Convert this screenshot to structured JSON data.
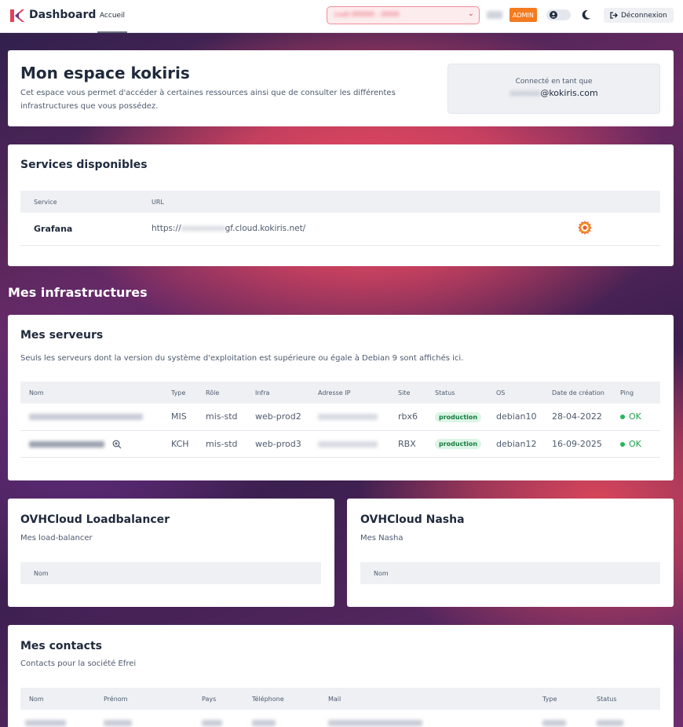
{
  "topbar": {
    "brand": "Dashboard",
    "nav_home": "Accueil",
    "customer_selected": "cust-00000 - 0000",
    "admin_badge": "ADMIN",
    "logout_label": "Déconnexion",
    "brand_color": "#e3405a"
  },
  "welcome": {
    "title": "Mon espace kokiris",
    "description": "Cet espace vous permet d'accéder à certaines ressources ainsi que de consulter les différentes infrastructures que vous possédez.",
    "connected_label": "Connecté en tant que",
    "email_hidden": "xxxxxx",
    "email_domain": "@kokiris.com"
  },
  "services": {
    "title": "Services disponibles",
    "columns": [
      "Service",
      "URL"
    ],
    "rows": [
      {
        "name": "Grafana",
        "url_prefix": "https://",
        "url_hidden": "xxxxxxxxx",
        "url_suffix": "gf.cloud.kokiris.net/",
        "icon": "grafana-icon"
      }
    ]
  },
  "infra_heading": "Mes infrastructures",
  "servers": {
    "title": "Mes serveurs",
    "description": "Seuls les serveurs dont la version du système d'exploitation est supérieure ou égale à Debian 9 sont affichés ici.",
    "columns": [
      "Nom",
      "Type",
      "Rôle",
      "Infra",
      "Adresse IP",
      "Site",
      "Status",
      "OS",
      "Date de création",
      "Ping"
    ],
    "rows": [
      {
        "type": "MIS",
        "role": "mis-std",
        "infra": "web-prod2",
        "site": "rbx6",
        "status": "production",
        "os": "debian10",
        "created": "28-04-2022",
        "ping": "OK"
      },
      {
        "type": "KCH",
        "role": "mis-std",
        "infra": "web-prod3",
        "site": "RBX",
        "status": "production",
        "os": "debian12",
        "created": "16-09-2025",
        "ping": "OK"
      }
    ]
  },
  "loadbalancer": {
    "title": "OVHCloud Loadbalancer",
    "subtitle": "Mes load-balancer",
    "column": "Nom"
  },
  "nasha": {
    "title": "OVHCloud Nasha",
    "subtitle": "Mes Nasha",
    "column": "Nom"
  },
  "contacts": {
    "title": "Mes contacts",
    "subtitle": "Contacts pour la société Efrei",
    "columns": [
      "Nom",
      "Prénom",
      "Pays",
      "Téléphone",
      "Mail",
      "Type",
      "Status"
    ]
  }
}
